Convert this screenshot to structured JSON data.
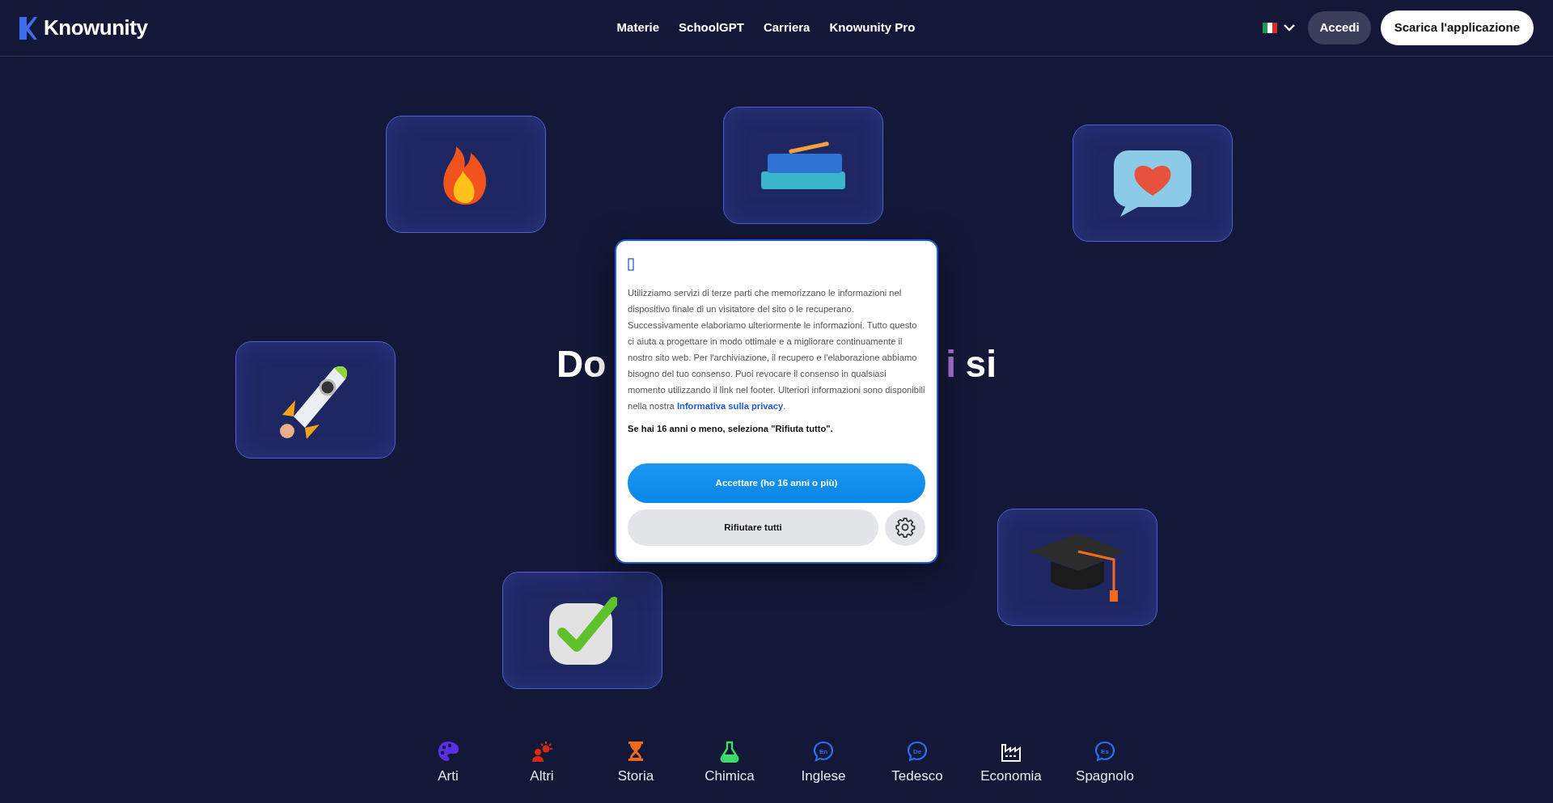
{
  "header": {
    "brand": "Knowunity",
    "nav": [
      "Materie",
      "SchoolGPT",
      "Carriera",
      "Knowunity Pro"
    ],
    "language": {
      "expanded": false
    },
    "login_button": "Accedi",
    "download_button": "Scarica l'applicazione"
  },
  "tiles": [
    {
      "kind": "fire"
    },
    {
      "kind": "books"
    },
    {
      "kind": "heart"
    },
    {
      "kind": "rocket"
    },
    {
      "kind": "check"
    },
    {
      "kind": "cap"
    }
  ],
  "heading": {
    "left": "Do",
    "right": [
      {
        "text": "i",
        "highlight": true
      },
      {
        "text": "si",
        "highlight": false
      }
    ]
  },
  "cookie_dialog": {
    "text": "Utilizziamo servizi di terze parti che memorizzano le informazioni nel dispositivo finale di un visitatore del sito o le recuperano. Successivamente elaboriamo ulteriormente le informazioni. Tutto questo ci aiuta a progettare in modo ottimale e a migliorare continuamente il nostro sito web. Per l'archiviazione, il recupero e l'elaborazione abbiamo bisogno del tuo consenso. Puoi revocare il consenso in qualsiasi momento utilizzando il link nel footer. Ulteriori informazioni sono disponibili nella nostra",
    "link": "Informativa sulla privacy",
    "after": ".",
    "notice": "Se hai 16 anni o meno, seleziona \"Rifiuta tutto\".",
    "accept_button": "Accettare (ho 16 anni o più)",
    "reject_button": "Rifiutare tutti"
  },
  "subjects": [
    {
      "label": "Arti",
      "kind": "palette",
      "color": "#5b2ee8"
    },
    {
      "label": "Altri",
      "kind": "people",
      "color": "#d42a12"
    },
    {
      "label": "Storia",
      "kind": "hourglass",
      "color": "#f26b1d"
    },
    {
      "label": "Chimica",
      "kind": "flask",
      "color": "#3ddc6b"
    },
    {
      "label": "Inglese",
      "kind": "speech",
      "color": "#2f6ee8",
      "badge": "En"
    },
    {
      "label": "Tedesco",
      "kind": "speech",
      "color": "#2f6ee8",
      "badge": "De"
    },
    {
      "label": "Economia",
      "kind": "factory",
      "color": "#ffffff"
    },
    {
      "label": "Spagnolo",
      "kind": "speech",
      "color": "#2f6ee8",
      "badge": "Es"
    }
  ]
}
